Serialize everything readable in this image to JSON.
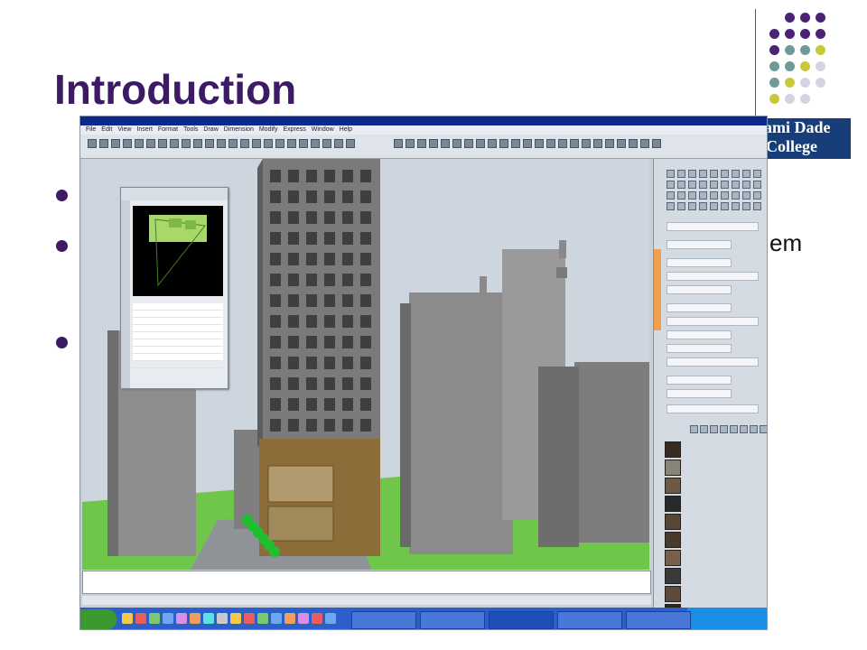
{
  "slide": {
    "title": "Introduction",
    "partial_bullet_text": "em"
  },
  "logo": {
    "line1": "ami Dade",
    "line2": "College"
  },
  "colors": {
    "title": "#3d1a64",
    "dot_purple": "#4b2275",
    "dot_teal": "#6f9a99",
    "dot_yellow": "#c9c83a",
    "dot_lavender": "#d7d3e3",
    "logo_bg": "#173e78",
    "ground": "#6fc64a",
    "sky": "#cdd6df"
  },
  "screenshot": {
    "menu_items": [
      "File",
      "Edit",
      "View",
      "Insert",
      "Format",
      "Tools",
      "Draw",
      "Dimension",
      "Modify",
      "Express",
      "Window",
      "Help"
    ]
  }
}
